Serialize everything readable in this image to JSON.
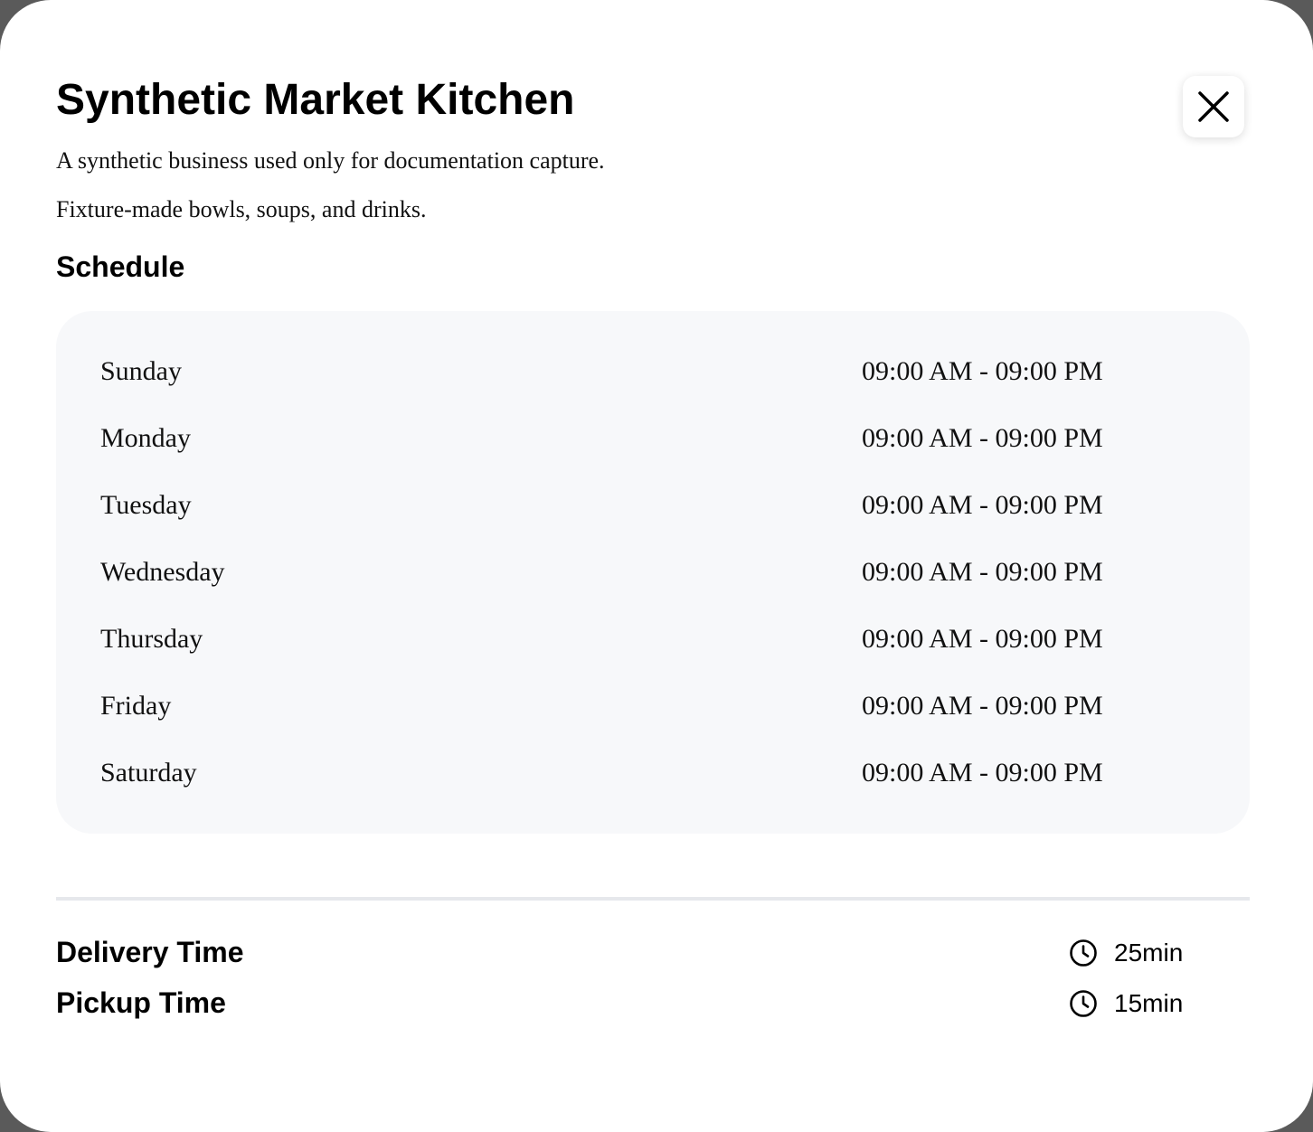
{
  "title": "Synthetic Market Kitchen",
  "description": "A synthetic business used only for documentation capture.",
  "tagline": "Fixture-made bowls, soups, and drinks.",
  "close_icon": "close-icon",
  "schedule": {
    "heading": "Schedule",
    "rows": [
      {
        "day": "Sunday",
        "hours": "09:00 AM - 09:00 PM"
      },
      {
        "day": "Monday",
        "hours": "09:00 AM - 09:00 PM"
      },
      {
        "day": "Tuesday",
        "hours": "09:00 AM - 09:00 PM"
      },
      {
        "day": "Wednesday",
        "hours": "09:00 AM - 09:00 PM"
      },
      {
        "day": "Thursday",
        "hours": "09:00 AM - 09:00 PM"
      },
      {
        "day": "Friday",
        "hours": "09:00 AM - 09:00 PM"
      },
      {
        "day": "Saturday",
        "hours": "09:00 AM - 09:00 PM"
      }
    ]
  },
  "times": {
    "delivery": {
      "label": "Delivery Time",
      "value": "25min",
      "icon": "clock-icon"
    },
    "pickup": {
      "label": "Pickup Time",
      "value": "15min",
      "icon": "clock-icon"
    }
  },
  "colors": {
    "background": "#ffffff",
    "schedule_bg": "#f7f8fa",
    "divider": "#e6e8ec",
    "text": "#000000"
  }
}
